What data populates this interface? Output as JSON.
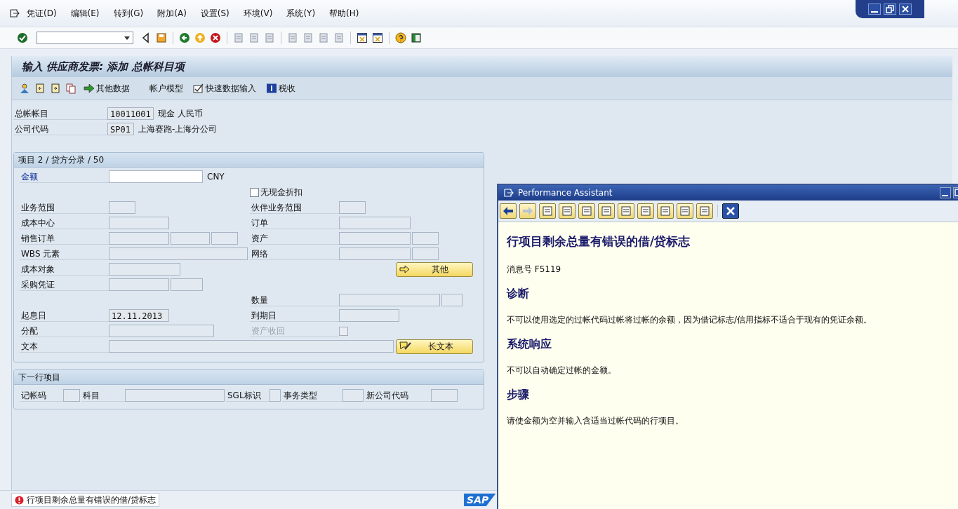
{
  "menu": [
    {
      "label": "凭证(D)"
    },
    {
      "label": "编辑(E)"
    },
    {
      "label": "转到(G)"
    },
    {
      "label": "附加(A)"
    },
    {
      "label": "设置(S)"
    },
    {
      "label": "环境(V)"
    },
    {
      "label": "系统(Y)"
    },
    {
      "label": "帮助(H)"
    }
  ],
  "screen_title": "输入 供应商发票: 添加 总帐科目项",
  "app_toolbar": [
    {
      "label": "其他数据",
      "kind": "icon"
    },
    {
      "label": "帐户模型",
      "kind": "plain"
    },
    {
      "label": "快速数据输入",
      "kind": "icon"
    },
    {
      "label": "税收",
      "kind": "icon"
    }
  ],
  "header_fields": [
    {
      "label": "总帐帐目",
      "value": "10011001",
      "description": "现金 人民币"
    },
    {
      "label": "公司代码",
      "value": "SP01",
      "description": "上海赛跑-上海分公司"
    }
  ],
  "item_section": {
    "title": "项目 2 / 贷方分录 / 50",
    "fields": [
      {
        "kind": "field",
        "label": "金额",
        "required": true,
        "unit": "CNY"
      },
      {
        "kind": "checkbox",
        "label": "无现金折扣",
        "checked": false,
        "disabled": false
      },
      {
        "kind": "field",
        "label": "业务范围"
      },
      {
        "kind": "field",
        "label": "伙伴业务范围"
      },
      {
        "kind": "field",
        "label": "成本中心"
      },
      {
        "kind": "field",
        "label": "订单"
      },
      {
        "kind": "field",
        "label": "销售订单"
      },
      {
        "kind": "field",
        "label": "资产"
      },
      {
        "kind": "field",
        "label": "WBS 元素"
      },
      {
        "kind": "field",
        "label": "网络"
      },
      {
        "kind": "field",
        "label": "成本对象"
      },
      {
        "kind": "button",
        "label": "其他"
      },
      {
        "kind": "field",
        "label": "采购凭证"
      },
      {
        "kind": "field",
        "label": "数量"
      },
      {
        "kind": "field",
        "label": "起息日",
        "value": "12.11.2013"
      },
      {
        "kind": "field",
        "label": "到期日"
      },
      {
        "kind": "field",
        "label": "分配"
      },
      {
        "kind": "checkbox",
        "label": "资产收回",
        "checked": false,
        "disabled": true
      },
      {
        "kind": "field",
        "label": "文本"
      },
      {
        "kind": "button",
        "label": "长文本"
      }
    ]
  },
  "next_line_section": {
    "title": "下一行项目",
    "fields": [
      {
        "label": "记帐码"
      },
      {
        "label": "科目"
      },
      {
        "label": "SGL标识"
      },
      {
        "label": "事务类型"
      },
      {
        "label": "新公司代码"
      }
    ]
  },
  "assistant": {
    "title": "Performance Assistant",
    "heading": "行项目剩余总量有错误的借/贷标志",
    "message_number": "消息号  F5119",
    "sections": [
      {
        "heading": "诊断",
        "text": "不可以使用选定的过帐代码过帐将过帐的余额，因为借记标志/信用指标不适合于现有的凭证余额。"
      },
      {
        "heading": "系统响应",
        "text": "不可以自动确定过帐的金额。"
      },
      {
        "heading": "步骤",
        "text": "请使金额为空并输入含适当过帐代码的行项目。"
      }
    ]
  },
  "status_bar": {
    "kind": "error",
    "message": "行项目剩余总量有错误的借/贷标志",
    "logo": "SAP"
  }
}
